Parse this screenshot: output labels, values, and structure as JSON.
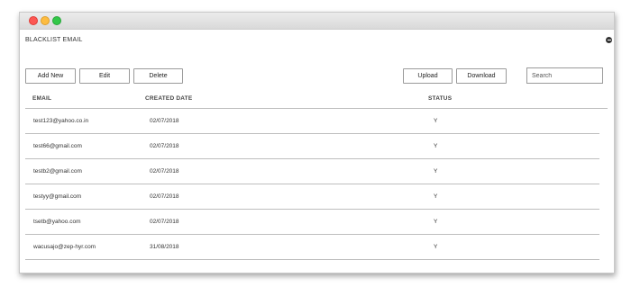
{
  "window": {
    "title": ""
  },
  "page": {
    "title": "BLACKLIST EMAIL"
  },
  "toolbar": {
    "add_new": "Add New",
    "edit": "Edit",
    "delete": "Delete",
    "upload": "Upload",
    "download": "Download",
    "search_placeholder": "Search"
  },
  "table": {
    "columns": {
      "email": "EMAIL",
      "created_date": "CREATED DATE",
      "status": "STATUS"
    },
    "rows": [
      {
        "email": "test123@yahoo.co.in",
        "created_date": "02/07/2018",
        "status": "Y"
      },
      {
        "email": "test66@gmail.com",
        "created_date": "02/07/2018",
        "status": "Y"
      },
      {
        "email": "testb2@gmail.com",
        "created_date": "02/07/2018",
        "status": "Y"
      },
      {
        "email": "testyy@gmail.com",
        "created_date": "02/07/2018",
        "status": "Y"
      },
      {
        "email": "tsetb@yahoo.com",
        "created_date": "02/07/2018",
        "status": "Y"
      },
      {
        "email": "wacusajo@zep-hyr.com",
        "created_date": "31/08/2018",
        "status": "Y"
      }
    ]
  },
  "colors": {
    "close": "#fc5753",
    "minimize": "#fdbc40",
    "maximize": "#33c748",
    "border": "#9a9a9a"
  },
  "icons": {
    "collapse": "minus-circle-icon"
  }
}
